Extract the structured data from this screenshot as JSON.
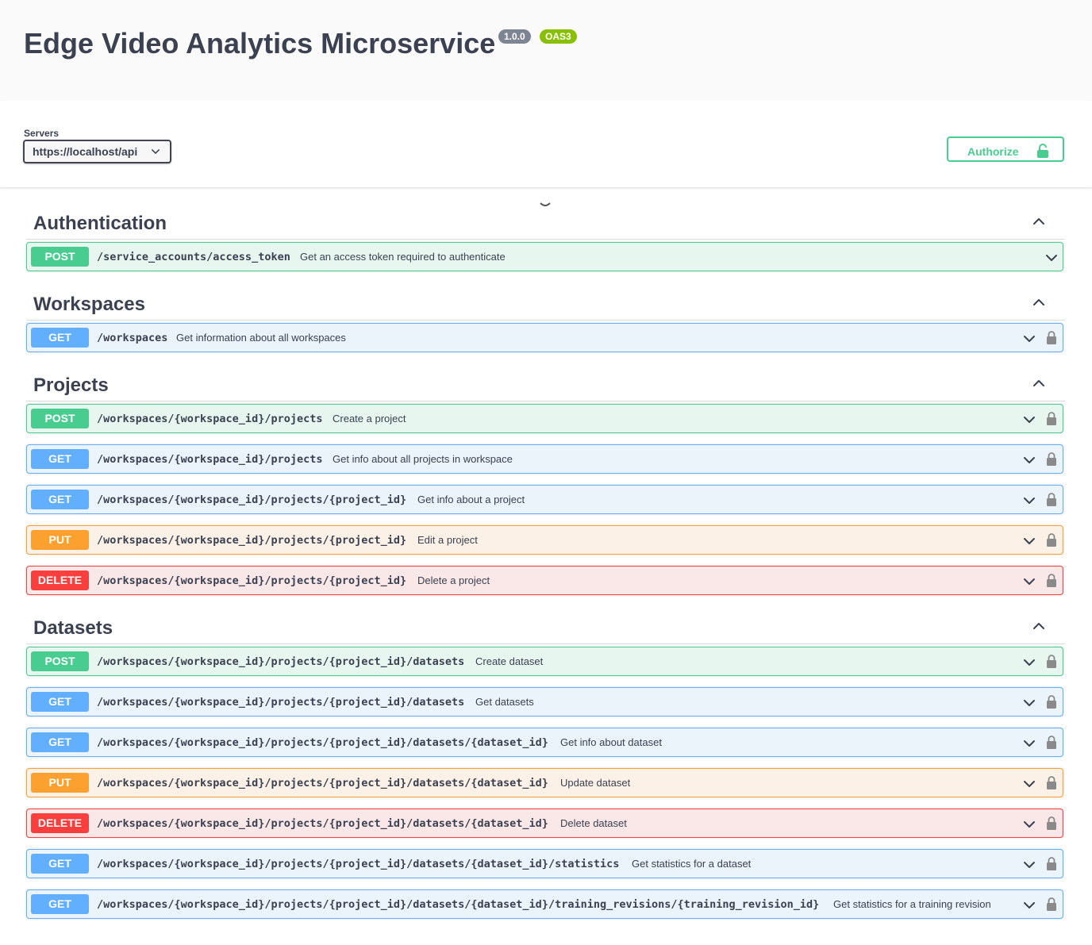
{
  "info": {
    "title": "Edge Video Analytics Microservice",
    "version": "1.0.0",
    "oas": "OAS3"
  },
  "servers": {
    "label": "Servers",
    "selected": "https://localhost/api"
  },
  "authorize": {
    "label": "Authorize"
  },
  "colors": {
    "post": "#49cc90",
    "get": "#61affe",
    "put": "#fca130",
    "delete": "#f93e3e"
  },
  "tags": [
    {
      "name": "Authentication",
      "operations": [
        {
          "method": "POST",
          "path": "/service_accounts/access_token",
          "summary": "Get an access token required to authenticate",
          "locked": false
        }
      ]
    },
    {
      "name": "Workspaces",
      "operations": [
        {
          "method": "GET",
          "path": "/workspaces",
          "summary": "Get information about all workspaces",
          "locked": true
        }
      ]
    },
    {
      "name": "Projects",
      "operations": [
        {
          "method": "POST",
          "path": "/workspaces/{workspace_id}/projects",
          "summary": "Create a project",
          "locked": true
        },
        {
          "method": "GET",
          "path": "/workspaces/{workspace_id}/projects",
          "summary": "Get info about all projects in workspace",
          "locked": true
        },
        {
          "method": "GET",
          "path": "/workspaces/{workspace_id}/projects/{project_id}",
          "summary": "Get info about a project",
          "locked": true
        },
        {
          "method": "PUT",
          "path": "/workspaces/{workspace_id}/projects/{project_id}",
          "summary": "Edit a project",
          "locked": true
        },
        {
          "method": "DELETE",
          "path": "/workspaces/{workspace_id}/projects/{project_id}",
          "summary": "Delete a project",
          "locked": true
        }
      ]
    },
    {
      "name": "Datasets",
      "operations": [
        {
          "method": "POST",
          "path": "/workspaces/{workspace_id}/projects/{project_id}/datasets",
          "summary": "Create dataset",
          "locked": true
        },
        {
          "method": "GET",
          "path": "/workspaces/{workspace_id}/projects/{project_id}/datasets",
          "summary": "Get datasets",
          "locked": true
        },
        {
          "method": "GET",
          "path": "/workspaces/{workspace_id}/projects/{project_id}/datasets/{dataset_id}",
          "summary": "Get info about dataset",
          "locked": true
        },
        {
          "method": "PUT",
          "path": "/workspaces/{workspace_id}/projects/{project_id}/datasets/{dataset_id}",
          "summary": "Update dataset",
          "locked": true
        },
        {
          "method": "DELETE",
          "path": "/workspaces/{workspace_id}/projects/{project_id}/datasets/{dataset_id}",
          "summary": "Delete dataset",
          "locked": true
        },
        {
          "method": "GET",
          "path": "/workspaces/{workspace_id}/projects/{project_id}/datasets/{dataset_id}/statistics",
          "summary": "Get statistics for a dataset",
          "locked": true
        },
        {
          "method": "GET",
          "path": "/workspaces/{workspace_id}/projects/{project_id}/datasets/{dataset_id}/training_revisions/{training_revision_id}",
          "summary": "Get statistics for a training revision",
          "locked": true
        }
      ]
    }
  ]
}
